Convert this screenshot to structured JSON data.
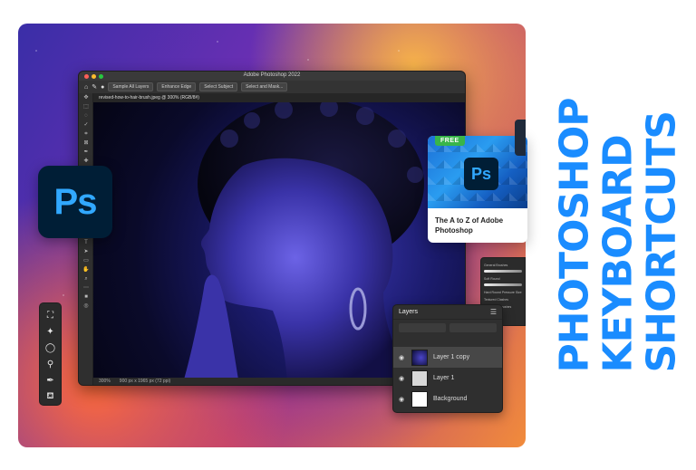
{
  "window": {
    "title": "Adobe Photoshop 2022",
    "document_tab": "revised-how-to-hair-brush.jpeg @ 300% (RGB/8#)",
    "options": [
      "Sample All Layers",
      "Enhance Edge",
      "Select Subject",
      "Select and Mask..."
    ],
    "status_zoom": "300%",
    "status_info": "900 px x 1965 px (72 ppi)"
  },
  "logo": {
    "text": "Ps"
  },
  "card": {
    "badge": "FREE",
    "logo_text": "Ps",
    "title": "The A to Z of Adobe Photoshop"
  },
  "layers_panel": {
    "title": "Layers",
    "items": [
      {
        "name": "Layer 1 copy",
        "selected": true
      },
      {
        "name": "Layer 1",
        "selected": false
      },
      {
        "name": "Background",
        "selected": false
      }
    ]
  },
  "brushes_panel": {
    "labels": [
      "General Brushes",
      "Soft Round",
      "Hard Round Pressure Size",
      "Textured Clashes",
      "Watercolor brushes"
    ]
  },
  "heading": {
    "line1": "PHOTOSHOP",
    "line2": "KEYBOARD",
    "line3": "SHORTCUTS"
  },
  "palette_icons": [
    "marquee-icon",
    "magic-wand-icon",
    "lasso-icon",
    "stamp-icon",
    "eyedropper-icon",
    "paint-bucket-icon"
  ],
  "colors": {
    "ps_blue": "#31a8ff",
    "ps_dark": "#001e36",
    "heading_blue": "#1a8cff",
    "free_green": "#39b54a"
  }
}
